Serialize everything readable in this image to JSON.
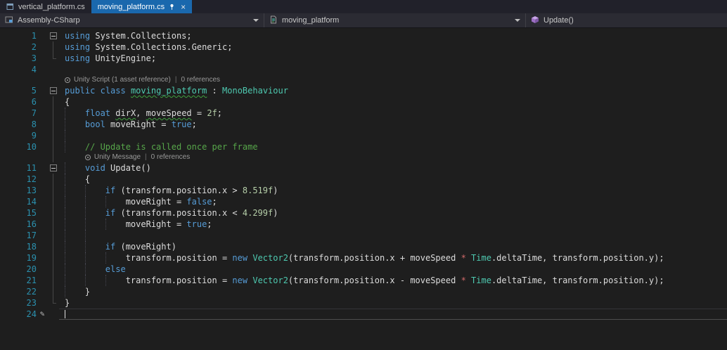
{
  "tabbar": {
    "tabs": [
      {
        "label": "vertical_platform.cs",
        "active": false
      },
      {
        "label": "moving_platform.cs",
        "active": true,
        "pinned": true,
        "closable": true
      }
    ]
  },
  "navbar": {
    "project": {
      "label": "Assembly-CSharp",
      "icon": "csharp-project-icon"
    },
    "type": {
      "label": "moving_platform",
      "icon": "unity-script-icon"
    },
    "member": {
      "label": "Update()",
      "icon": "method-icon"
    }
  },
  "palette": {
    "editor_bg": "#1e1e1e",
    "active_tab": "#1a68ad",
    "keyword": "#569cd6",
    "type": "#4ec9b0",
    "comment": "#57a64a",
    "number": "#b5cea8",
    "plain": "#dcdcdc",
    "overloaded_operator": "#d16969",
    "line_number": "#2b91af",
    "codelens_text": "#9a9a9a"
  },
  "editor": {
    "cursor_line": 24,
    "lines": [
      {
        "n": 1,
        "fold": "box",
        "tokens": [
          [
            "k",
            "using"
          ],
          [
            "p",
            " System.Collections;"
          ]
        ]
      },
      {
        "n": 2,
        "fold": "line",
        "tokens": [
          [
            "k",
            "using"
          ],
          [
            "p",
            " System.Collections.Generic;"
          ]
        ]
      },
      {
        "n": 3,
        "fold": "end",
        "tokens": [
          [
            "k",
            "using"
          ],
          [
            "p",
            " UnityEngine;"
          ]
        ]
      },
      {
        "n": 4,
        "tokens": []
      },
      {
        "n": 5,
        "fold": "box",
        "lens": {
          "indent": 0,
          "gline": false,
          "segments": [
            "Unity Script (1 asset reference)",
            "0 references"
          ]
        },
        "tokens": [
          [
            "k",
            "public"
          ],
          [
            "p",
            " "
          ],
          [
            "k",
            "class"
          ],
          [
            "p",
            " "
          ],
          [
            "tsq",
            "moving_platform"
          ],
          [
            "p",
            " : "
          ],
          [
            "t",
            "MonoBehaviour"
          ]
        ]
      },
      {
        "n": 6,
        "fold": "line",
        "tokens": [
          [
            "p",
            "{"
          ]
        ]
      },
      {
        "n": 7,
        "fold": "line",
        "guides": [
          0
        ],
        "tokens": [
          [
            "p",
            "    "
          ],
          [
            "k",
            "float"
          ],
          [
            "p",
            " "
          ],
          [
            "psq",
            "dirX"
          ],
          [
            "p",
            ", "
          ],
          [
            "psq",
            "moveSpeed"
          ],
          [
            "p",
            " = "
          ],
          [
            "num",
            "2f"
          ],
          [
            "p",
            ";"
          ]
        ]
      },
      {
        "n": 8,
        "fold": "line",
        "guides": [
          0
        ],
        "tokens": [
          [
            "p",
            "    "
          ],
          [
            "k",
            "bool"
          ],
          [
            "p",
            " moveRight = "
          ],
          [
            "k",
            "true"
          ],
          [
            "p",
            ";"
          ]
        ]
      },
      {
        "n": 9,
        "fold": "line",
        "guides": [
          0
        ],
        "tokens": []
      },
      {
        "n": 10,
        "fold": "line",
        "guides": [
          0
        ],
        "tokens": [
          [
            "p",
            "    "
          ],
          [
            "c",
            "// Update is called once per frame"
          ]
        ]
      },
      {
        "n": 11,
        "fold": "box",
        "guides": [
          0
        ],
        "lens": {
          "indent": 4,
          "gline": true,
          "segments": [
            "Unity Message",
            "0 references"
          ]
        },
        "tokens": [
          [
            "p",
            "    "
          ],
          [
            "k",
            "void"
          ],
          [
            "p",
            " Update()"
          ]
        ]
      },
      {
        "n": 12,
        "fold": "line",
        "guides": [
          0
        ],
        "tokens": [
          [
            "p",
            "    {"
          ]
        ]
      },
      {
        "n": 13,
        "fold": "line",
        "guides": [
          0,
          4
        ],
        "tokens": [
          [
            "p",
            "        "
          ],
          [
            "k",
            "if"
          ],
          [
            "p",
            " (transform.position.x > "
          ],
          [
            "num",
            "8.519f"
          ],
          [
            "p",
            ")"
          ]
        ]
      },
      {
        "n": 14,
        "fold": "line",
        "guides": [
          0,
          4,
          8
        ],
        "tokens": [
          [
            "p",
            "            moveRight = "
          ],
          [
            "k",
            "false"
          ],
          [
            "p",
            ";"
          ]
        ]
      },
      {
        "n": 15,
        "fold": "line",
        "guides": [
          0,
          4
        ],
        "tokens": [
          [
            "p",
            "        "
          ],
          [
            "k",
            "if"
          ],
          [
            "p",
            " (transform.position.x < "
          ],
          [
            "num",
            "4.299f"
          ],
          [
            "p",
            ")"
          ]
        ]
      },
      {
        "n": 16,
        "fold": "line",
        "guides": [
          0,
          4,
          8
        ],
        "tokens": [
          [
            "p",
            "            moveRight = "
          ],
          [
            "k",
            "true"
          ],
          [
            "p",
            ";"
          ]
        ]
      },
      {
        "n": 17,
        "fold": "line",
        "guides": [
          0,
          4
        ],
        "tokens": []
      },
      {
        "n": 18,
        "fold": "line",
        "guides": [
          0,
          4
        ],
        "tokens": [
          [
            "p",
            "        "
          ],
          [
            "k",
            "if"
          ],
          [
            "p",
            " (moveRight)"
          ]
        ]
      },
      {
        "n": 19,
        "fold": "line",
        "guides": [
          0,
          4,
          8
        ],
        "tokens": [
          [
            "p",
            "            transform.position = "
          ],
          [
            "k",
            "new"
          ],
          [
            "p",
            " "
          ],
          [
            "t",
            "Vector2"
          ],
          [
            "p",
            "(transform.position.x + moveSpeed "
          ],
          [
            "o",
            "*"
          ],
          [
            "p",
            " "
          ],
          [
            "t",
            "Time"
          ],
          [
            "p",
            ".deltaTime, transform.position.y);"
          ]
        ]
      },
      {
        "n": 20,
        "fold": "line",
        "guides": [
          0,
          4
        ],
        "tokens": [
          [
            "p",
            "        "
          ],
          [
            "k",
            "else"
          ]
        ]
      },
      {
        "n": 21,
        "fold": "line",
        "guides": [
          0,
          4,
          8
        ],
        "tokens": [
          [
            "p",
            "            transform.position = "
          ],
          [
            "k",
            "new"
          ],
          [
            "p",
            " "
          ],
          [
            "t",
            "Vector2"
          ],
          [
            "p",
            "(transform.position.x - moveSpeed "
          ],
          [
            "o",
            "*"
          ],
          [
            "p",
            " "
          ],
          [
            "t",
            "Time"
          ],
          [
            "p",
            ".deltaTime, transform.position.y);"
          ]
        ]
      },
      {
        "n": 22,
        "fold": "line",
        "guides": [
          0
        ],
        "tokens": [
          [
            "p",
            "    }"
          ]
        ]
      },
      {
        "n": 23,
        "fold": "end",
        "tokens": [
          [
            "p",
            "}"
          ]
        ]
      },
      {
        "n": 24,
        "tokens": []
      }
    ]
  }
}
